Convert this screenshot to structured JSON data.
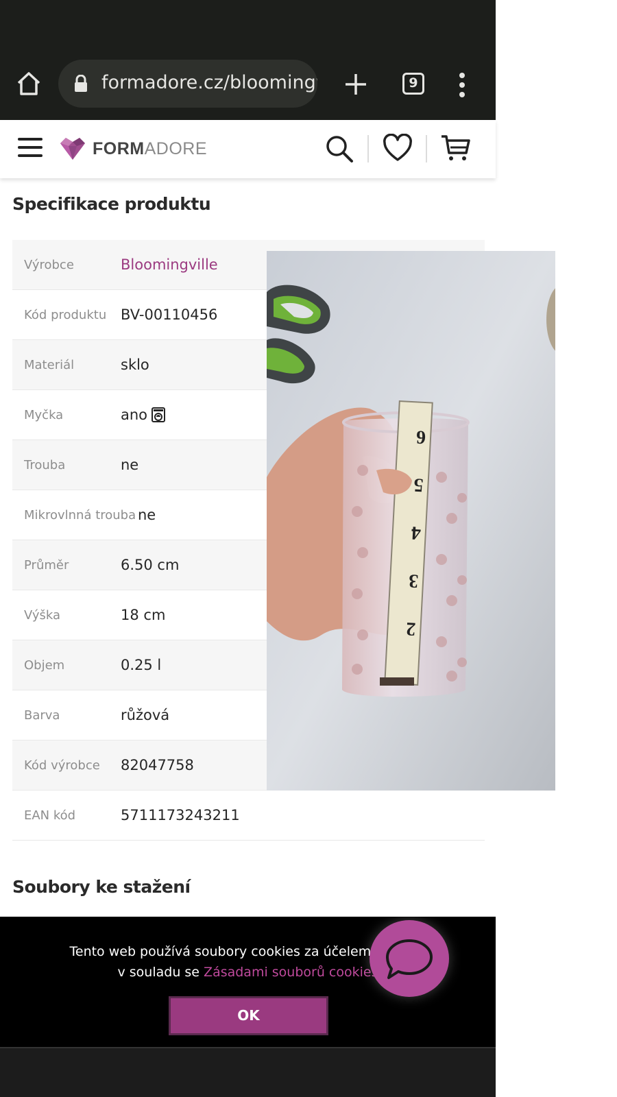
{
  "browser": {
    "url": "formadore.cz/bloomingv",
    "tab_count": "9",
    "icons": {
      "home": "home-icon",
      "lock": "lock-icon",
      "new_tab": "plus-icon",
      "menu": "more-vertical-icon"
    }
  },
  "header": {
    "brand_bold": "FORM",
    "brand_light": "ADORE",
    "icons": {
      "menu": "hamburger-icon",
      "search": "search-icon",
      "wishlist": "heart-icon",
      "cart": "cart-icon"
    }
  },
  "specs": {
    "title": "Specifikace produktu",
    "rows": [
      {
        "label": "Výrobce",
        "value": "Bloomingville"
      },
      {
        "label": "Kód produktu",
        "value": "BV-00110456"
      },
      {
        "label": "Materiál",
        "value": "sklo"
      },
      {
        "label": "Myčka",
        "value": "ano"
      },
      {
        "label": "Trouba",
        "value": "ne"
      },
      {
        "label": "Mikrovlnná trouba",
        "value": "ne"
      },
      {
        "label": "Průměr",
        "value": "6.50 cm"
      },
      {
        "label": "Výška",
        "value": "18 cm"
      },
      {
        "label": "Objem",
        "value": "0.25 l"
      },
      {
        "label": "Barva",
        "value": "růžová"
      },
      {
        "label": "Kód výrobce",
        "value": "82047758"
      },
      {
        "label": "EAN kód",
        "value": "5711173243211"
      }
    ]
  },
  "downloads": {
    "title": "Soubory ke stažení"
  },
  "cookie": {
    "line1": "Tento web používá soubory cookies za účelem poskyto",
    "line2_prefix": "v souladu se ",
    "line2_link": "Zásadami souborů cookies",
    "ok_label": "OK"
  },
  "colors": {
    "accent": "#9a3a80",
    "link": "#9b3a80",
    "chrome": "#1c1e1b"
  }
}
